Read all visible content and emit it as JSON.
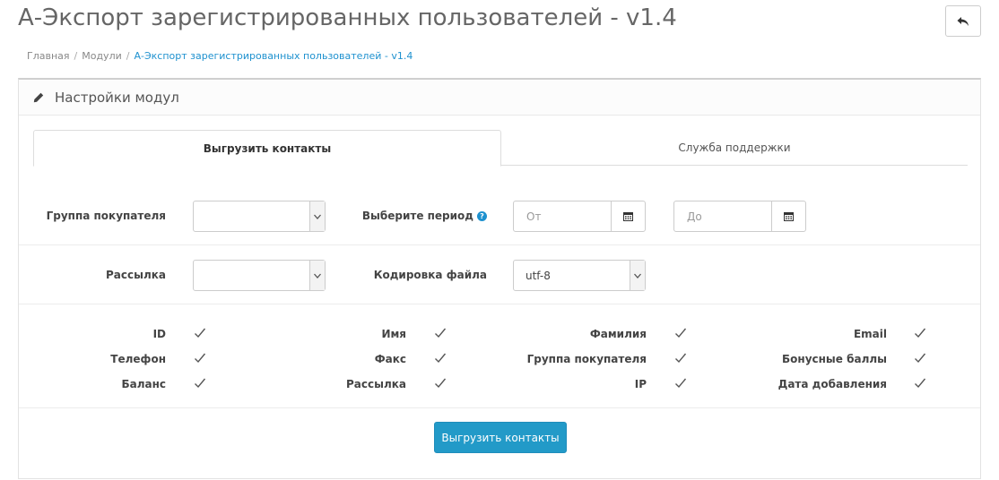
{
  "header": {
    "title": "А-Экспорт зарегистрированных пользователей - v1.4",
    "back_icon": "reply-icon"
  },
  "breadcrumb": {
    "items": [
      "Главная",
      "Модули",
      "А-Экспорт зарегистрированных пользователей - v1.4"
    ],
    "separator": "/"
  },
  "panel": {
    "title": "Настройки модул",
    "icon": "pencil-icon"
  },
  "tabs": [
    {
      "label": "Выгрузить контакты",
      "active": true
    },
    {
      "label": "Служба поддержки",
      "active": false
    }
  ],
  "form": {
    "customer_group_label": "Группа покупателя",
    "customer_group_value": "",
    "period_label": "Выберите период",
    "period_help_icon": "question-circle-icon",
    "date_from_placeholder": "От",
    "date_to_placeholder": "До",
    "calendar_icon": "calendar-icon",
    "newsletter_label": "Рассылка",
    "newsletter_value": "",
    "encoding_label": "Кодировка файла",
    "encoding_value": "utf-8"
  },
  "fields": [
    {
      "label": "ID",
      "checked": true
    },
    {
      "label": "Имя",
      "checked": true
    },
    {
      "label": "Фамилия",
      "checked": true
    },
    {
      "label": "Email",
      "checked": true
    },
    {
      "label": "Телефон",
      "checked": true
    },
    {
      "label": "Факс",
      "checked": true
    },
    {
      "label": "Группа покупателя",
      "checked": true
    },
    {
      "label": "Бонусные баллы",
      "checked": true
    },
    {
      "label": "Баланс",
      "checked": true
    },
    {
      "label": "Рассылка",
      "checked": true
    },
    {
      "label": "IP",
      "checked": true
    },
    {
      "label": "Дата добавления",
      "checked": true
    }
  ],
  "export_button": {
    "label": "Выгрузить контакты"
  },
  "colors": {
    "accent": "#229ac8",
    "link": "#1e91cf"
  }
}
